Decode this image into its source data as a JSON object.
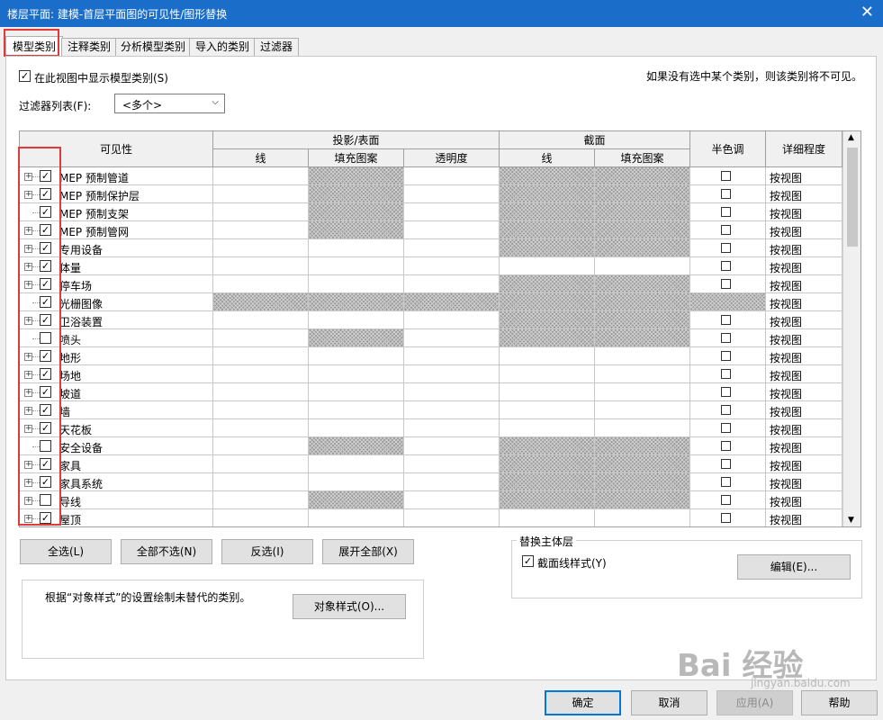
{
  "window": {
    "title": "楼层平面: 建模-首层平面图的可见性/图形替换",
    "close": "✕"
  },
  "tabs": [
    "模型类别",
    "注释类别",
    "分析模型类别",
    "导入的类别",
    "过滤器"
  ],
  "options": {
    "show_categories_label": "在此视图中显示模型类别(S)",
    "show_categories_checked": true,
    "hint": "如果没有选中某个类别，则该类别将不可见。",
    "filter_label": "过滤器列表(F):",
    "filter_value": "<多个>"
  },
  "table": {
    "headers": {
      "visibility": "可见性",
      "projection": "投影/表面",
      "cut": "截面",
      "halftone": "半色调",
      "detail": "详细程度",
      "line": "线",
      "fill": "填充图案",
      "transparency": "透明度",
      "cut_line": "线",
      "cut_fill": "填充图案"
    },
    "rows": [
      {
        "name": "MEP 预制管道",
        "visible": true,
        "expandable": true
      },
      {
        "name": "MEP 预制保护层",
        "visible": true,
        "expandable": true
      },
      {
        "name": "MEP 预制支架",
        "visible": true,
        "expandable": false
      },
      {
        "name": "MEP 预制管网",
        "visible": true,
        "expandable": true
      },
      {
        "name": "专用设备",
        "visible": true,
        "expandable": true
      },
      {
        "name": "体量",
        "visible": true,
        "expandable": true
      },
      {
        "name": "停车场",
        "visible": true,
        "expandable": true
      },
      {
        "name": "光栅图像",
        "visible": true,
        "expandable": false
      },
      {
        "name": "卫浴装置",
        "visible": true,
        "expandable": true
      },
      {
        "name": "喷头",
        "visible": false,
        "expandable": false
      },
      {
        "name": "地形",
        "visible": true,
        "expandable": true
      },
      {
        "name": "场地",
        "visible": true,
        "expandable": true
      },
      {
        "name": "坡道",
        "visible": true,
        "expandable": true
      },
      {
        "name": "墙",
        "visible": true,
        "expandable": true
      },
      {
        "name": "天花板",
        "visible": true,
        "expandable": true
      },
      {
        "name": "安全设备",
        "visible": false,
        "expandable": false
      },
      {
        "name": "家具",
        "visible": true,
        "expandable": true
      },
      {
        "name": "家具系统",
        "visible": true,
        "expandable": true
      },
      {
        "name": "导线",
        "visible": false,
        "expandable": true
      },
      {
        "name": "屋顶",
        "visible": true,
        "expandable": true
      }
    ],
    "detail_value": "按视图"
  },
  "buttons": {
    "select_all": "全选(L)",
    "select_none": "全部不选(N)",
    "invert": "反选(I)",
    "expand_all": "展开全部(X)",
    "object_styles": "对象样式(O)...",
    "edit": "编辑(E)...",
    "ok": "确定",
    "cancel": "取消",
    "apply": "应用(A)",
    "help": "帮助"
  },
  "host_layers": {
    "title": "替换主体层",
    "cut_line_styles": "截面线样式(Y)",
    "cut_line_styles_checked": true
  },
  "info": {
    "text": "根据“对象样式”的设置绘制未替代的类别。"
  },
  "watermark": {
    "brand": "Bai 经验",
    "site": "jingyan.baidu.com"
  }
}
